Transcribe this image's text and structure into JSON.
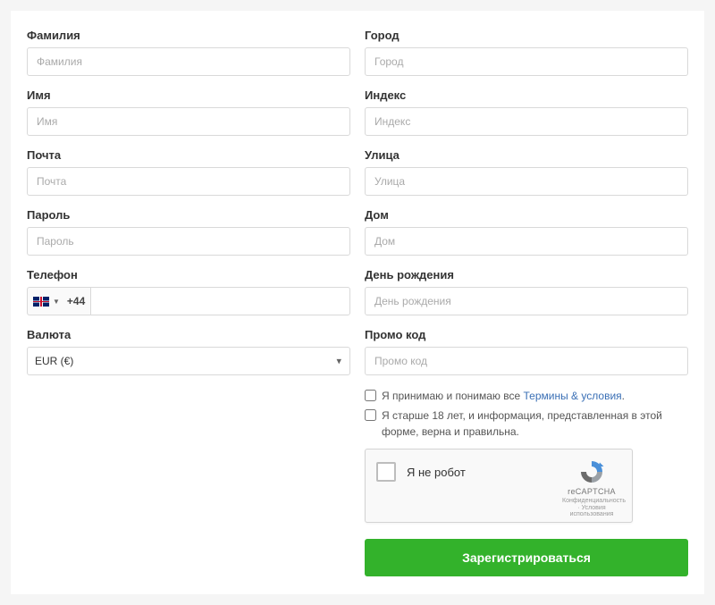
{
  "left": {
    "surname": {
      "label": "Фамилия",
      "placeholder": "Фамилия"
    },
    "name": {
      "label": "Имя",
      "placeholder": "Имя"
    },
    "email": {
      "label": "Почта",
      "placeholder": "Почта"
    },
    "password": {
      "label": "Пароль",
      "placeholder": "Пароль"
    },
    "phone": {
      "label": "Телефон",
      "dial": "+44"
    },
    "currency": {
      "label": "Валюта",
      "value": "EUR  (€)"
    }
  },
  "right": {
    "city": {
      "label": "Город",
      "placeholder": "Город"
    },
    "zip": {
      "label": "Индекс",
      "placeholder": "Индекс"
    },
    "street": {
      "label": "Улица",
      "placeholder": "Улица"
    },
    "house": {
      "label": "Дом",
      "placeholder": "Дом"
    },
    "dob": {
      "label": "День рождения",
      "placeholder": "День рождения"
    },
    "promo": {
      "label": "Промо код",
      "placeholder": "Промо код"
    }
  },
  "agree": {
    "terms_prefix": "Я принимаю и понимаю все ",
    "terms_link": "Термины & условия",
    "terms_suffix": ".",
    "age": "Я старше 18 лет, и информация, представленная в этой форме, верна и правильна."
  },
  "captcha": {
    "label": "Я не робот",
    "brand": "reCAPTCHA",
    "legal": "Конфиденциальность  ·  Условия использования"
  },
  "submit": "Зарегистрироваться"
}
